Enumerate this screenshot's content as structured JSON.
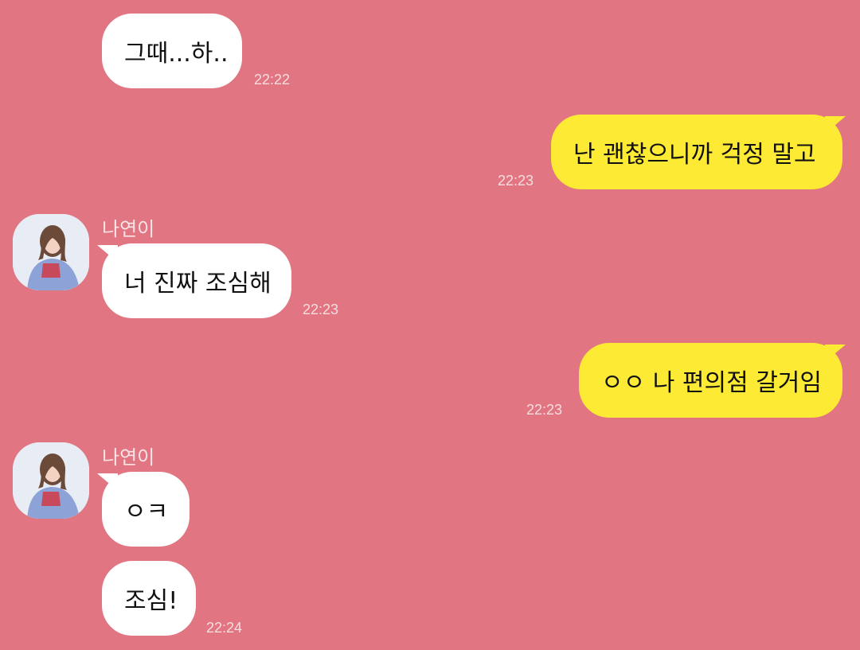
{
  "colors": {
    "background": "#e17682",
    "incoming_bubble": "#ffffff",
    "outgoing_bubble": "#fdea35",
    "timestamp": "#f6dde0"
  },
  "messages": [
    {
      "direction": "in",
      "text": "그때...하..",
      "time": "22:22"
    },
    {
      "direction": "out",
      "text": "난 괜찮으니까 걱정 말고",
      "time": "22:23"
    },
    {
      "direction": "in",
      "sender": "나연이",
      "avatar_icon": "profile-photo",
      "text": "너 진짜 조심해",
      "time": "22:23"
    },
    {
      "direction": "out",
      "text": "ㅇㅇ 나 편의점 갈거임",
      "time": "22:23"
    },
    {
      "direction": "in",
      "sender": "나연이",
      "avatar_icon": "profile-photo",
      "text": "ㅇㅋ",
      "time": ""
    },
    {
      "direction": "in",
      "text": "조심!",
      "time": "22:24"
    }
  ]
}
